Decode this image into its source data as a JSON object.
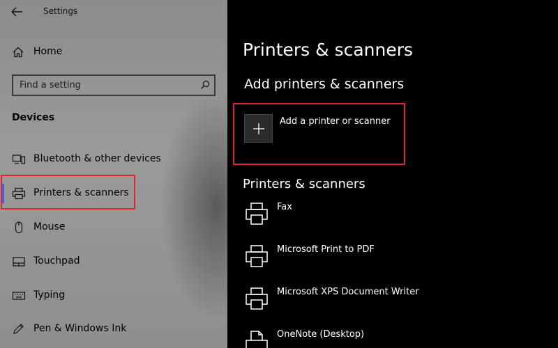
{
  "window": {
    "title": "Settings"
  },
  "sidebar": {
    "home_label": "Home",
    "search": {
      "placeholder": "Find a setting"
    },
    "section_title": "Devices",
    "items": [
      {
        "label": "Bluetooth & other devices",
        "icon": "bluetooth-icon"
      },
      {
        "label": "Printers & scanners",
        "icon": "printer-icon",
        "selected": true
      },
      {
        "label": "Mouse",
        "icon": "mouse-icon"
      },
      {
        "label": "Touchpad",
        "icon": "touchpad-icon"
      },
      {
        "label": "Typing",
        "icon": "keyboard-icon"
      },
      {
        "label": "Pen & Windows Ink",
        "icon": "pen-icon"
      }
    ]
  },
  "main": {
    "title": "Printers & scanners",
    "add_section_title": "Add printers & scanners",
    "add_button_label": "Add a printer or scanner",
    "list_section_title": "Printers & scanners",
    "printers": [
      {
        "name": "Fax",
        "icon": "printer-icon"
      },
      {
        "name": "Microsoft Print to PDF",
        "icon": "printer-icon"
      },
      {
        "name": "Microsoft XPS Document Writer",
        "icon": "printer-icon"
      },
      {
        "name": "OneNote (Desktop)",
        "icon": "printer-document-icon"
      }
    ]
  },
  "colors": {
    "sidebar_bg": "#9a9b99",
    "main_bg": "#000000",
    "accent": "#3b5ee8",
    "annotation_red": "#e0262e",
    "tile_bg": "#2b2b2b"
  }
}
